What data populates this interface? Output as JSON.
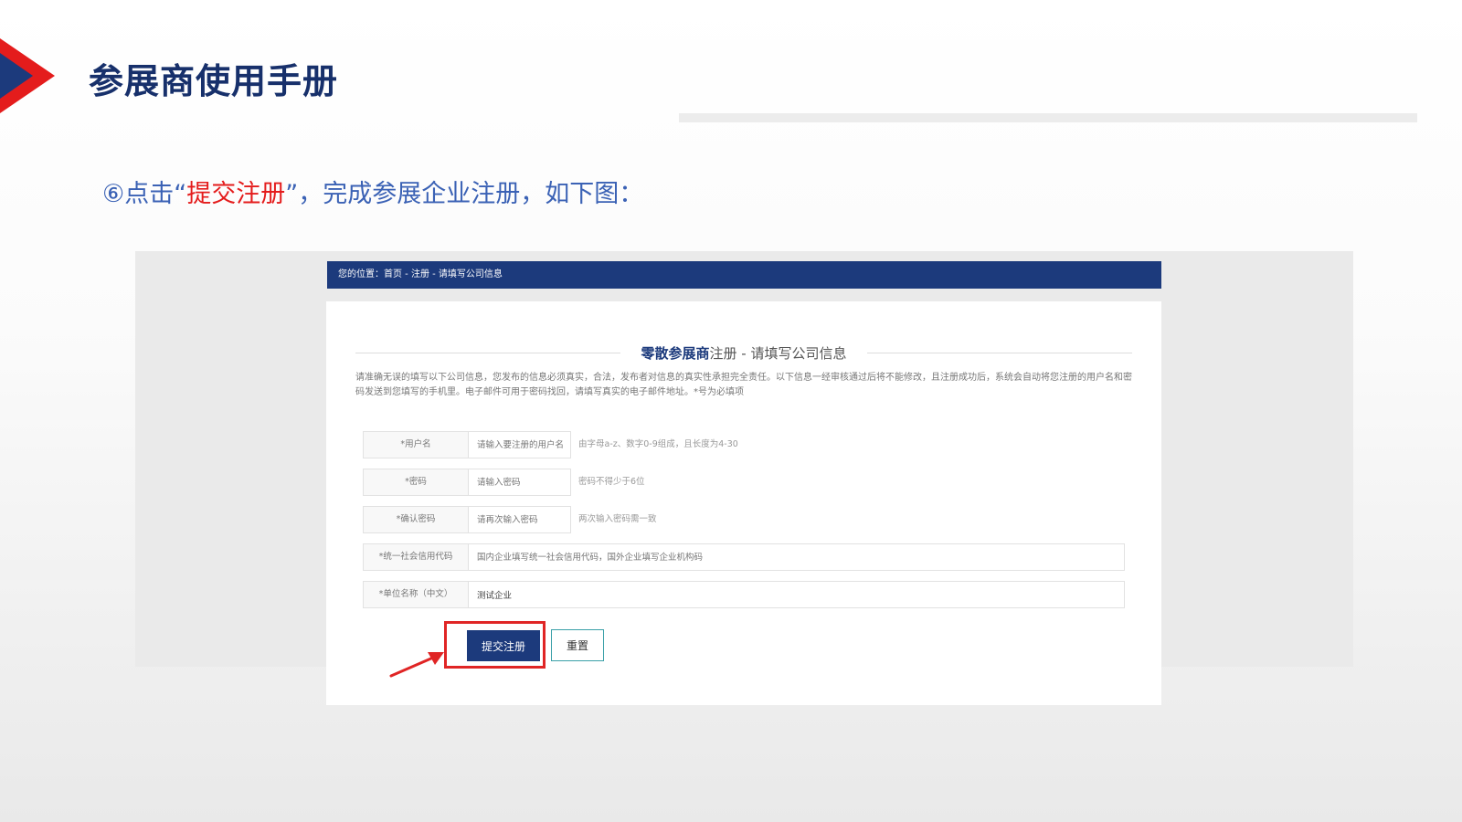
{
  "header": {
    "title": "参展商使用手册"
  },
  "instruction": {
    "prefix": "⑥点击“",
    "highlight": "提交注册",
    "suffix": "”，完成参展企业注册，如下图："
  },
  "screenshot": {
    "breadcrumb": "您的位置：首页 - 注册 - 请填写公司信息",
    "card_title_strong": "零散参展商",
    "card_title_rest": "注册 - 请填写公司信息",
    "description": "请准确无误的填写以下公司信息，您发布的信息必须真实，合法，发布者对信息的真实性承担完全责任。以下信息一经审核通过后将不能修改，且注册成功后，系统会自动将您注册的用户名和密码发送到您填写的手机里。电子邮件可用于密码找回，请填写真实的电子邮件地址。*号为必填项",
    "fields": [
      {
        "label": "*用户名",
        "placeholder": "请输入要注册的用户名",
        "hint": "由字母a-z、数字0-9组成，且长度为4-30"
      },
      {
        "label": "*密码",
        "placeholder": "请输入密码",
        "hint": "密码不得少于6位"
      },
      {
        "label": "*确认密码",
        "placeholder": "请再次输入密码",
        "hint": "两次输入密码需一致"
      },
      {
        "label": "*统一社会信用代码",
        "placeholder": "国内企业填写统一社会信用代码，国外企业填写企业机构码",
        "hint": ""
      },
      {
        "label": "*单位名称（中文）",
        "value": "测试企业",
        "hint": ""
      }
    ],
    "submit_label": "提交注册",
    "reset_label": "重置"
  },
  "colors": {
    "brand_navy": "#1c3a7c",
    "accent_red": "#e02525",
    "instruction_blue": "#3b62b5"
  }
}
